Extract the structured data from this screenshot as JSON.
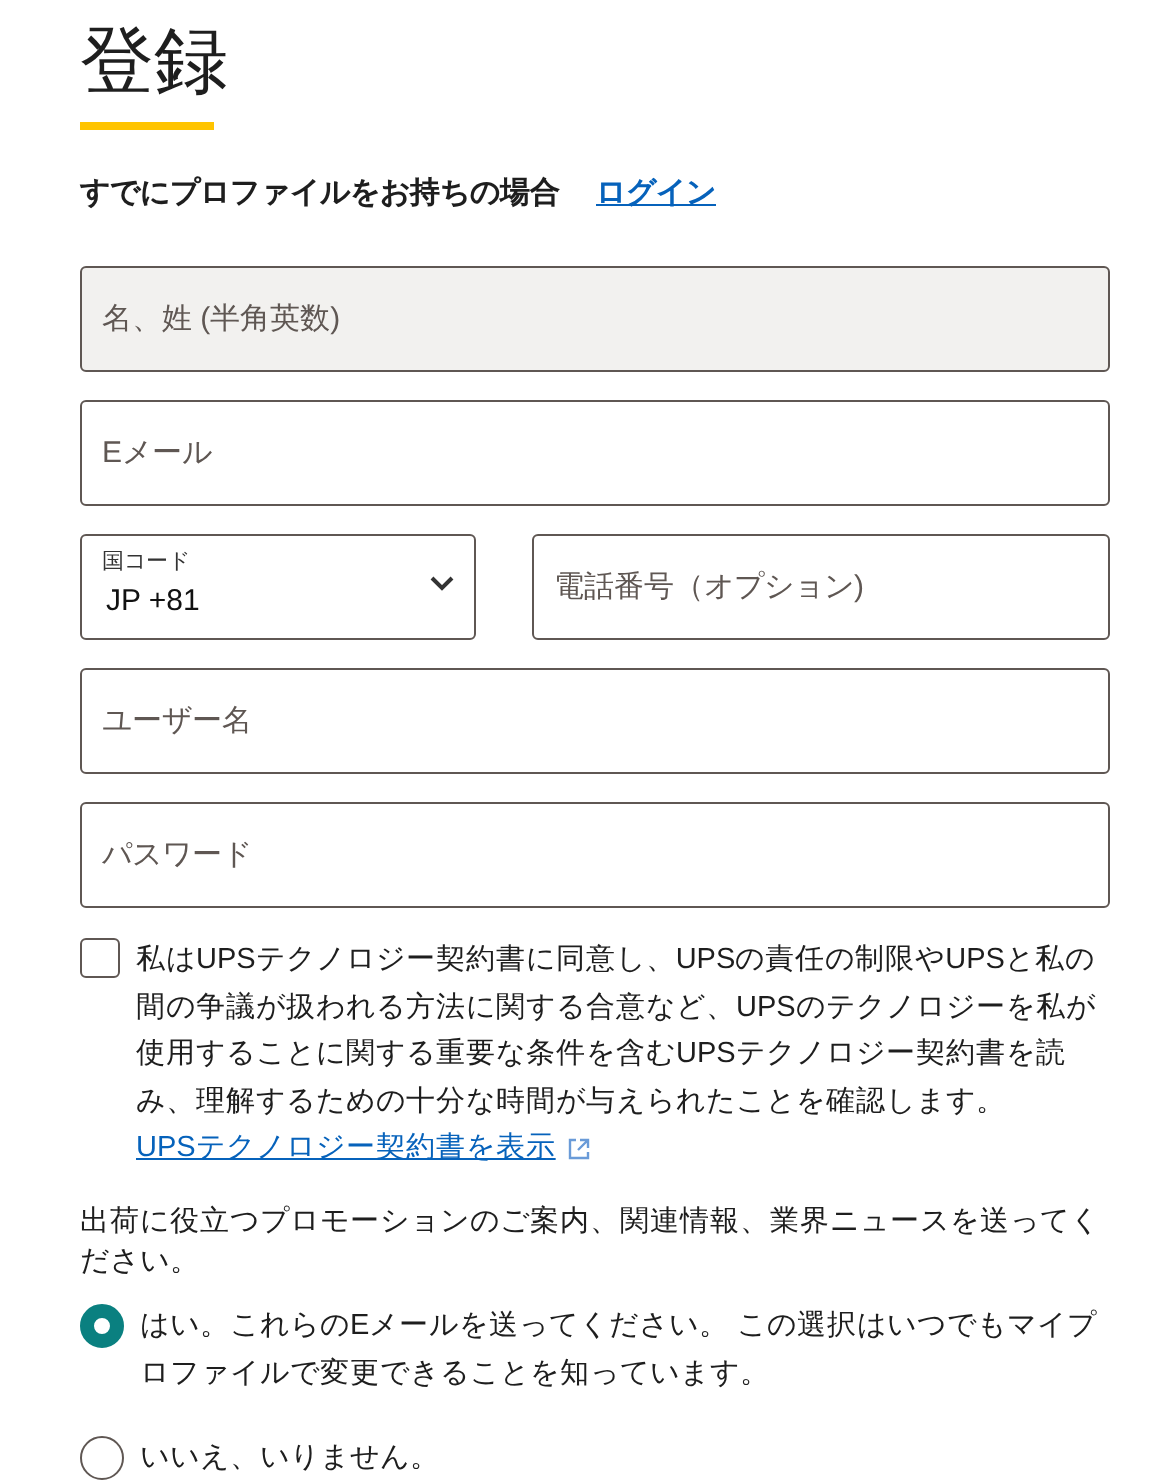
{
  "title": "登録",
  "login_prompt": {
    "text": "すでにプロファイルをお持ちの場合",
    "link": "ログイン"
  },
  "fields": [
    {
      "kind": "text",
      "placeholder": "名、姓 (半角英数)",
      "disabled": true
    },
    {
      "kind": "text",
      "placeholder": "Eメール",
      "disabled": false
    },
    {
      "kind": "phone",
      "country_label": "国コード",
      "country_value": "JP +81",
      "placeholder": "電話番号（オプション)",
      "disabled": false
    },
    {
      "kind": "text",
      "placeholder": "ユーザー名",
      "disabled": false
    },
    {
      "kind": "text",
      "placeholder": "パスワード",
      "disabled": false
    }
  ],
  "agreement": {
    "checked": false,
    "text": "私はUPSテクノロジー契約書に同意し、UPSの責任の制限やUPSと私の間の争議が扱われる方法に関する合意など、UPSのテクノロジーを私が使用することに関する重要な条件を含むUPSテクノロジー契約書を読み、理解するための十分な時間が与えられたことを確認します。",
    "link": "UPSテクノロジー契約書を表示"
  },
  "promo": {
    "question": "出荷に役立つプロモーションのご案内、関連情報、業界ニュースを送ってください。",
    "options": [
      {
        "label": "はい。これらのEメールを送ってください。 この選択はいつでもマイプロファイルで変更できることを知っています。",
        "selected": true
      },
      {
        "label": "いいえ、いりません。",
        "selected": false
      }
    ]
  }
}
